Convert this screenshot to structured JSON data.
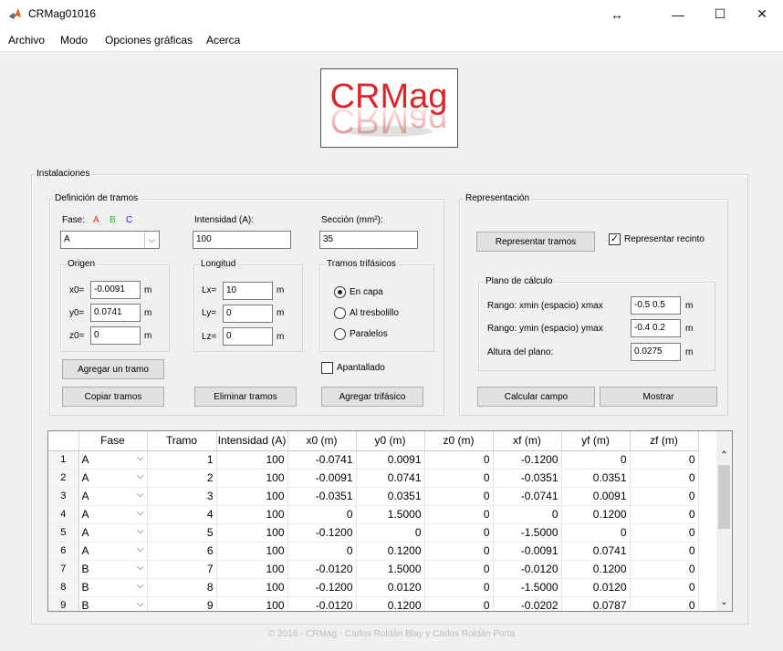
{
  "window": {
    "title": "CRMag01016",
    "icon": "matlab-icon"
  },
  "window_controls": {
    "swap": "↔",
    "minimize": "—",
    "maximize": "☐",
    "close": "✕"
  },
  "menu": [
    "Archivo",
    "Modo",
    "Opciones gráficas",
    "Acerca"
  ],
  "logo": {
    "text": "CRMag"
  },
  "instalaciones": {
    "title": "Instalaciones",
    "definicion": {
      "title": "Definición de tramos",
      "fase_label": "Fase:",
      "fase_letters": [
        "A",
        "B",
        "C"
      ],
      "fase_colors": [
        "#ff2020",
        "#20c020",
        "#2020ff"
      ],
      "fase_value": "A",
      "intensidad_label": "Intensidad (A):",
      "intensidad_value": "100",
      "seccion_label": "Sección (mm²):",
      "seccion_value": "35",
      "origen": {
        "title": "Origen",
        "x_label": "x0=",
        "x_value": "-0.0091",
        "y_label": "y0=",
        "y_value": "0.0741",
        "z_label": "z0=",
        "z_value": "0",
        "unit": "m"
      },
      "longitud": {
        "title": "Longitud",
        "x_label": "Lx=",
        "x_value": "10",
        "y_label": "Ly=",
        "y_value": "0",
        "z_label": "Lz=",
        "z_value": "0",
        "unit": "m"
      },
      "trifasicos": {
        "title": "Tramos trifásicos",
        "options": [
          "En capa",
          "Al tresbolillo",
          "Paralelos"
        ],
        "selected": 0
      },
      "apantallado_label": "Apantallado",
      "apantallado_checked": false,
      "btn_agregar": "Agregar un tramo",
      "btn_copiar": "Copiar tramos",
      "btn_eliminar": "Eliminar tramos",
      "btn_trifasico": "Agregar trifásico"
    },
    "representacion": {
      "title": "Representación",
      "btn_representar": "Representar tramos",
      "recinto_label": "Representar recinto",
      "recinto_checked": true,
      "plano": {
        "title": "Plano de cálculo",
        "rango_x_label": "Rango: xmin (espacio) xmax",
        "rango_x_value": "-0.5 0.5",
        "rango_y_label": "Rango: ymin (espacio) ymax",
        "rango_y_value": "-0.4 0.2",
        "altura_label": "Altura del plano:",
        "altura_value": "0.0275",
        "unit": "m"
      },
      "btn_calcular": "Calcular campo",
      "btn_mostrar": "Mostrar"
    }
  },
  "table": {
    "columns": [
      "Fase",
      "Tramo",
      "Intensidad (A)",
      "x0 (m)",
      "y0 (m)",
      "z0 (m)",
      "xf (m)",
      "yf (m)",
      "zf (m)"
    ],
    "rows": [
      [
        "1",
        "A",
        "1",
        "100",
        "-0.0741",
        "0.0091",
        "0",
        "-0.1200",
        "0",
        "0"
      ],
      [
        "2",
        "A",
        "2",
        "100",
        "-0.0091",
        "0.0741",
        "0",
        "-0.0351",
        "0.0351",
        "0"
      ],
      [
        "3",
        "A",
        "3",
        "100",
        "-0.0351",
        "0.0351",
        "0",
        "-0.0741",
        "0.0091",
        "0"
      ],
      [
        "4",
        "A",
        "4",
        "100",
        "0",
        "1.5000",
        "0",
        "0",
        "0.1200",
        "0"
      ],
      [
        "5",
        "A",
        "5",
        "100",
        "-0.1200",
        "0",
        "0",
        "-1.5000",
        "0",
        "0"
      ],
      [
        "6",
        "A",
        "6",
        "100",
        "0",
        "0.1200",
        "0",
        "-0.0091",
        "0.0741",
        "0"
      ],
      [
        "7",
        "B",
        "7",
        "100",
        "-0.0120",
        "1.5000",
        "0",
        "-0.0120",
        "0.1200",
        "0"
      ],
      [
        "8",
        "B",
        "8",
        "100",
        "-0.1200",
        "0.0120",
        "0",
        "-1.5000",
        "0.0120",
        "0"
      ],
      [
        "9",
        "B",
        "9",
        "100",
        "-0.0120",
        "0.1200",
        "0",
        "-0.0202",
        "0.0787",
        "0"
      ]
    ]
  },
  "footer": "© 2016 - CRMag - Carlos Roldán Blay y Carlos Roldán Porta"
}
